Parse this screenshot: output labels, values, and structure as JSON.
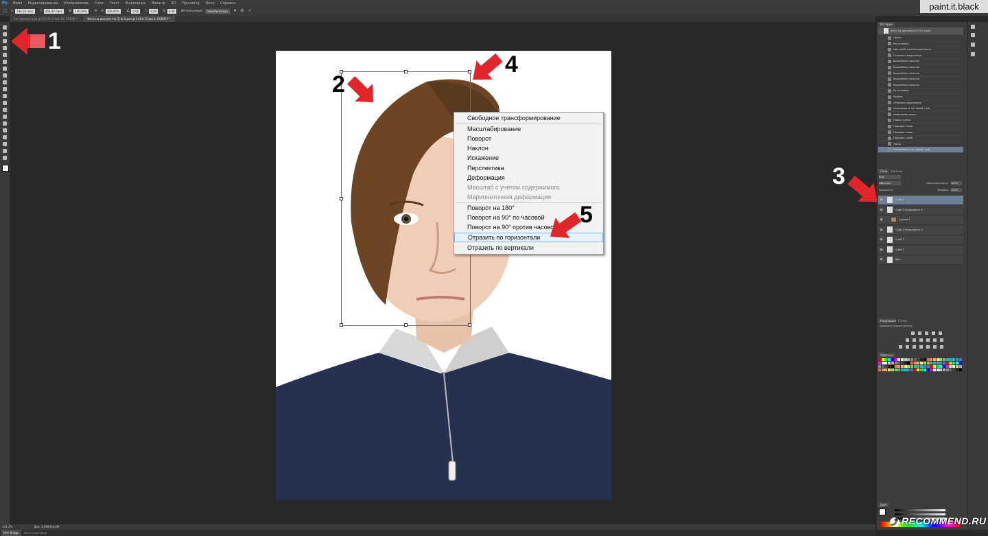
{
  "app": {
    "logo": "Ps",
    "menu": [
      "Файл",
      "Редактирование",
      "Изображение",
      "Слои",
      "Текст",
      "Выделение",
      "Фильтр",
      "3D",
      "Просмотр",
      "Окно",
      "Справка"
    ]
  },
  "options": {
    "x_value": "346,50 пикс",
    "y_value": "394,00 пикс",
    "w_value": "100,00%",
    "h_value": "100,00%",
    "angle_value": "0,00",
    "h_skew_value": "0,00",
    "v_skew_value": "0,00",
    "interp_label": "Интерполяция:",
    "interp_value": "Бикубическая"
  },
  "tabs": [
    {
      "label": "Без имени-1.psd @ 97,1% (Слой 16, RGB/8) *",
      "active": false
    },
    {
      "label": "Фото на документы 3 на 4.psd @ 141% (Слой 4, RGB/8*) *",
      "active": true
    }
  ],
  "context_menu": {
    "items": [
      {
        "label": "Свободное трансформирование",
        "state": "normal"
      },
      {
        "label": "Масштабирование",
        "state": "normal"
      },
      {
        "label": "Поворот",
        "state": "normal"
      },
      {
        "label": "Наклон",
        "state": "normal"
      },
      {
        "label": "Искажение",
        "state": "normal"
      },
      {
        "label": "Перспектива",
        "state": "normal"
      },
      {
        "label": "Деформация",
        "state": "normal"
      },
      {
        "label": "Масштаб с учетом содержимого",
        "state": "disabled"
      },
      {
        "label": "Марионеточная деформация",
        "state": "disabled"
      },
      {
        "label": "Поворот на 180°",
        "state": "normal"
      },
      {
        "label": "Поворот на 90° по часовой",
        "state": "normal"
      },
      {
        "label": "Поворот на 90° против часовой",
        "state": "normal"
      },
      {
        "label": "Отразить по горизонтали",
        "state": "highlighted"
      },
      {
        "label": "Отразить по вертикали",
        "state": "normal"
      }
    ]
  },
  "annotations": [
    "1",
    "2",
    "3",
    "4",
    "5"
  ],
  "history": {
    "tab_label": "История",
    "snapshot": "Фото на документы 3 на 4.psd",
    "items": [
      {
        "label": "Лассо",
        "selected": false
      },
      {
        "label": "Растушевка",
        "selected": false
      },
      {
        "label": "Цветовой тон/Насыщенность",
        "selected": false
      },
      {
        "label": "Отменить выделение",
        "selected": false
      },
      {
        "label": "Волшебная палочка",
        "selected": false
      },
      {
        "label": "Волшебная палочка",
        "selected": false
      },
      {
        "label": "Волшебная палочка",
        "selected": false
      },
      {
        "label": "Волшебная палочка",
        "selected": false
      },
      {
        "label": "Волшебная палочка",
        "selected": false
      },
      {
        "label": "Растушевка",
        "selected": false
      },
      {
        "label": "Уровни",
        "selected": false
      },
      {
        "label": "Отменить выделение",
        "selected": false
      },
      {
        "label": "Скопировать на новый слой",
        "selected": false
      },
      {
        "label": "Изменение цвета",
        "selected": false
      },
      {
        "label": "Новая группа",
        "selected": false
      },
      {
        "label": "Порядок слоев",
        "selected": false
      },
      {
        "label": "Порядок слоев",
        "selected": false
      },
      {
        "label": "Порядок слоев",
        "selected": false
      },
      {
        "label": "Лассо",
        "selected": false
      },
      {
        "label": "Скопировать на новый слой",
        "selected": true
      }
    ]
  },
  "layers": {
    "tab_layers": "Слои",
    "tab_channels": "Каналы",
    "filter": "Вид",
    "blend_mode": "Обычные",
    "opacity_label": "Непрозрачность:",
    "opacity_value": "100%",
    "lock_label": "Закрепить:",
    "fill_label": "Заливка:",
    "fill_value": "100%",
    "items": [
      {
        "name": "Слой 4",
        "selected": true
      },
      {
        "name": "Слой 3 Копировать 6",
        "selected": false
      },
      {
        "name": "Группа 1",
        "selected": false
      },
      {
        "name": "Слой 3 Копировать 5",
        "selected": false
      },
      {
        "name": "Слой 3",
        "selected": false
      },
      {
        "name": "Слой 2",
        "selected": false
      },
      {
        "name": "Фон",
        "selected": false
      }
    ]
  },
  "adjustments": {
    "tab_correction": "Коррекция",
    "tab_styles": "Стили",
    "hint": "Добавить корректировку"
  },
  "swatches": {
    "tab_label": "Образцы"
  },
  "color": {
    "tab_label": "Цвет"
  },
  "status": {
    "zoom": "141,2%",
    "doc": "Док: 3,99M/34,4M",
    "bridge_tab": "Mini Bridge",
    "timeline_tab": "Шкала времени"
  },
  "watermarks": {
    "top": "paint.it.black",
    "bottom": "RECOMMEND.RU"
  },
  "colors": {
    "arrow": "#e0262b",
    "selection": "#6d7f95",
    "menu_highlight": "#e5f1fb"
  }
}
